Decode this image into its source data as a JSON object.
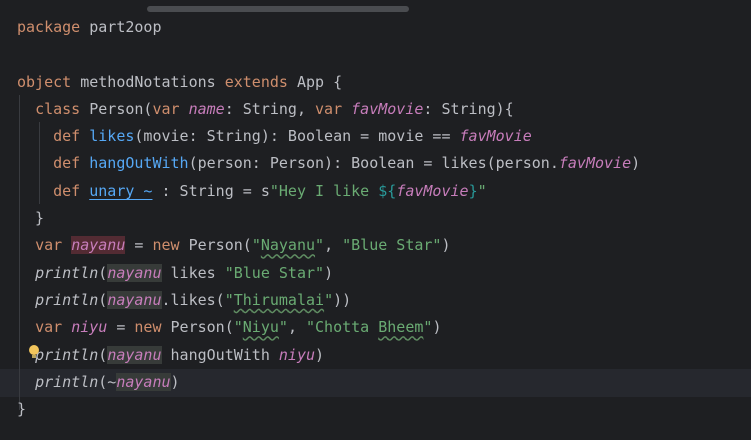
{
  "editor": {
    "lines": [
      [
        [
          "kw",
          "package"
        ],
        [
          "",
          " part2oop"
        ]
      ],
      [],
      [
        [
          "kw",
          "object"
        ],
        [
          "",
          " methodNotations "
        ],
        [
          "kw",
          "extends"
        ],
        [
          "",
          " App {"
        ]
      ],
      [
        [
          "",
          "  "
        ],
        [
          "kw",
          "class"
        ],
        [
          "",
          " Person("
        ],
        [
          "kw",
          "var"
        ],
        [
          "",
          " "
        ],
        [
          "prop",
          "name"
        ],
        [
          "",
          ": String, "
        ],
        [
          "kw",
          "var"
        ],
        [
          "",
          " "
        ],
        [
          "prop",
          "favMovie"
        ],
        [
          "",
          ": String){"
        ]
      ],
      [
        [
          "",
          "    "
        ],
        [
          "kw",
          "def"
        ],
        [
          "",
          " "
        ],
        [
          "fn",
          "likes"
        ],
        [
          "",
          "(movie: String): Boolean = movie == "
        ],
        [
          "prop",
          "favMovie"
        ]
      ],
      [
        [
          "",
          "    "
        ],
        [
          "kw",
          "def"
        ],
        [
          "",
          " "
        ],
        [
          "fn",
          "hangOutWith"
        ],
        [
          "",
          "(person: Person): Boolean = likes(person."
        ],
        [
          "prop",
          "favMovie"
        ],
        [
          "",
          ")"
        ]
      ],
      [
        [
          "",
          "    "
        ],
        [
          "kw",
          "def"
        ],
        [
          "",
          " "
        ],
        [
          "fn fnu",
          "unary_~"
        ],
        [
          "",
          " : String = s"
        ],
        [
          "str",
          "\"Hey I like "
        ],
        [
          "tpl",
          "${"
        ],
        [
          "prop",
          "favMovie"
        ],
        [
          "tpl",
          "}"
        ],
        [
          "str",
          "\""
        ]
      ],
      [
        [
          "",
          "  }"
        ]
      ],
      [
        [
          "",
          "  "
        ],
        [
          "kw",
          "var"
        ],
        [
          "",
          " "
        ],
        [
          "prop warn",
          "nayanu"
        ],
        [
          "",
          " = "
        ],
        [
          "kw",
          "new"
        ],
        [
          "",
          " Person("
        ],
        [
          "str",
          "\""
        ],
        [
          "str typo",
          "Nayanu"
        ],
        [
          "str",
          "\""
        ],
        [
          "",
          ", "
        ],
        [
          "str",
          "\"Blue Star\""
        ],
        [
          "",
          ")"
        ]
      ],
      [
        [
          "",
          "  "
        ],
        [
          "it",
          "println"
        ],
        [
          "",
          "("
        ],
        [
          "prop hl",
          "nayanu"
        ],
        [
          "",
          " likes "
        ],
        [
          "str",
          "\"Blue Star\""
        ],
        [
          "",
          ")"
        ]
      ],
      [
        [
          "",
          "  "
        ],
        [
          "it",
          "println"
        ],
        [
          "",
          "("
        ],
        [
          "prop hl",
          "nayanu"
        ],
        [
          "",
          ".likes("
        ],
        [
          "str",
          "\""
        ],
        [
          "str typo",
          "Thirumalai"
        ],
        [
          "str",
          "\""
        ],
        [
          "",
          "))"
        ]
      ],
      [
        [
          "",
          "  "
        ],
        [
          "kw",
          "var"
        ],
        [
          "",
          " "
        ],
        [
          "prop",
          "niyu"
        ],
        [
          "",
          " = "
        ],
        [
          "kw",
          "new"
        ],
        [
          "",
          " Person("
        ],
        [
          "str",
          "\""
        ],
        [
          "str typo",
          "Niyu"
        ],
        [
          "str",
          "\""
        ],
        [
          "",
          ", "
        ],
        [
          "str",
          "\"Chotta "
        ],
        [
          "str typo",
          "Bheem"
        ],
        [
          "str",
          "\""
        ],
        [
          "",
          ")"
        ]
      ],
      [
        [
          "",
          "  "
        ],
        [
          "it",
          "println"
        ],
        [
          "",
          "("
        ],
        [
          "prop hl",
          "nayanu"
        ],
        [
          "",
          " hangOutWith "
        ],
        [
          "prop",
          "niyu"
        ],
        [
          "",
          ")"
        ]
      ],
      [
        [
          "",
          "  "
        ],
        [
          "it",
          "println"
        ],
        [
          "",
          "(~"
        ],
        [
          "prop hl",
          "nayanu"
        ],
        [
          "",
          ")"
        ]
      ],
      [
        [
          "",
          "}"
        ]
      ]
    ]
  }
}
